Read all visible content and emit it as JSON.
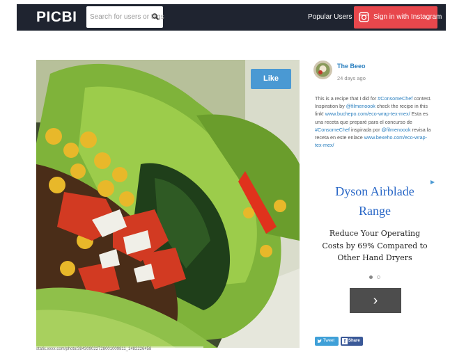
{
  "header": {
    "logo": "PICBI",
    "search_placeholder": "Search for users or tags",
    "popular_users": "Popular Users",
    "signin_label": "Sign in with Instagram"
  },
  "photo": {
    "like_label": "Like",
    "caption_url": "static.xxxx.com/photo/384309022728001009811_1482226458"
  },
  "post": {
    "author": "The Beeo",
    "time_ago": "24 days ago",
    "description": [
      {
        "text": "This is a recipe that I did for ",
        "tag": false
      },
      {
        "text": "#ConsomeChef",
        "tag": true
      },
      {
        "text": " contest. Inspiration by ",
        "tag": false
      },
      {
        "text": "@filmenoook",
        "tag": true
      },
      {
        "text": " check the recipe in this link! ",
        "tag": false
      },
      {
        "text": "www.buchepo.com/eco-wrap-tex-mex/",
        "tag": true
      },
      {
        "text": " Esta es una receta que preparé para el concurso de ",
        "tag": false
      },
      {
        "text": "#ConsomeChef",
        "tag": true
      },
      {
        "text": " inspirada por ",
        "tag": false
      },
      {
        "text": "@filmenoook",
        "tag": true
      },
      {
        "text": " revisa la receta en este enlace ",
        "tag": false
      },
      {
        "text": "www.bexeho.com/eco-wrap-tex-mex/",
        "tag": true
      }
    ]
  },
  "ad": {
    "title": "Dyson Airblade Range",
    "body": "Reduce Your Operating Costs by 69% Compared to Other Hand Dryers",
    "next_label": "›",
    "choices_icon": "adchoices-icon"
  },
  "share": {
    "tweet_label": "Tweet",
    "facebook_label": "Share"
  },
  "colors": {
    "topbar": "#1f2430",
    "signin": "#e8474c",
    "like": "#4a99d3",
    "link": "#2a7fbf",
    "ad_title": "#2a68c7",
    "ad_next": "#4d4d4d",
    "twitter": "#3fa0d8",
    "facebook": "#3b5998"
  }
}
